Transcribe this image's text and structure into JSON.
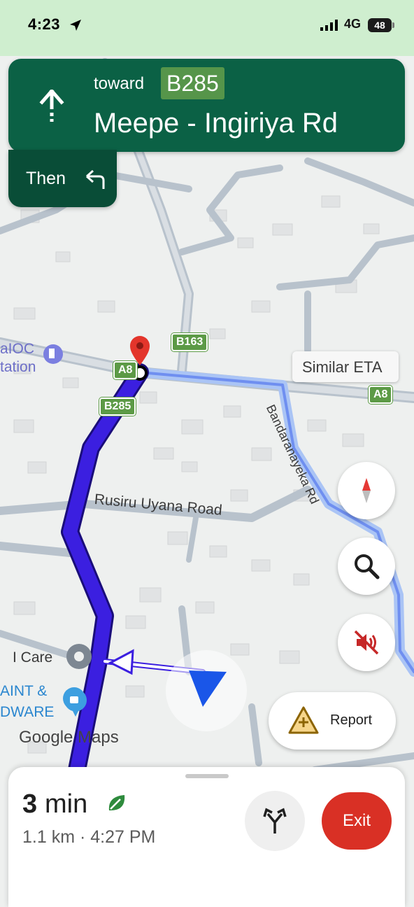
{
  "status_bar": {
    "time": "4:23",
    "network": "4G",
    "battery": "48"
  },
  "navigation": {
    "toward_label": "toward",
    "route_badge": "B285",
    "street_name": "Meepe - Ingiriya Rd",
    "then_label": "Then"
  },
  "map": {
    "eta_callout": "Similar ETA",
    "road_shields": {
      "b163": "B163",
      "a8_left": "A8",
      "a8_right": "A8",
      "b285": "B285"
    },
    "labels": {
      "ioc_top": "aIOC",
      "ioc_bottom": "tation",
      "rusiru_road": "Rusiru Uyana Road",
      "bandaranayeka": "Bandaranayeka Rd",
      "i_care": "I Care",
      "paint_top": "AINT &",
      "paint_bottom": "DWARE",
      "google_maps": "Google Maps"
    }
  },
  "controls": {
    "report_label": "Report"
  },
  "trip": {
    "eta_minutes": "3",
    "eta_unit": "min",
    "distance_time": "1.1 km · 4:27 PM",
    "exit_label": "Exit"
  },
  "colors": {
    "nav_green": "#0b6145",
    "nav_green_dark": "#094d37",
    "route_purple": "#3b1fe0",
    "exit_red": "#d93025"
  }
}
